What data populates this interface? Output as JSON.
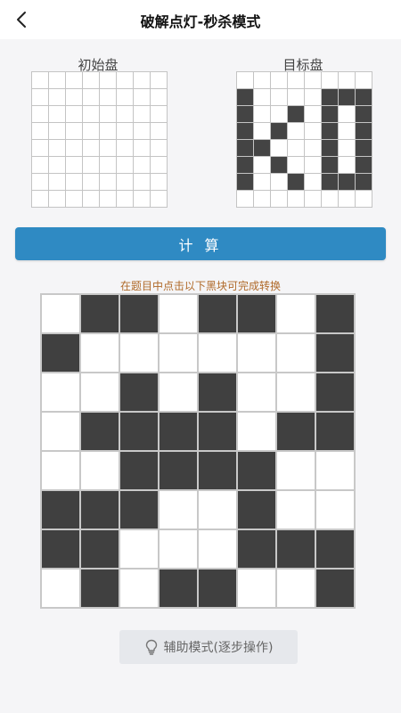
{
  "header": {
    "title": "破解点灯-秒杀模式",
    "back_icon": "chevron-left-icon"
  },
  "initial_board": {
    "label": "初始盘",
    "rows": [
      [
        0,
        0,
        0,
        0,
        0,
        0,
        0,
        0
      ],
      [
        0,
        0,
        0,
        0,
        0,
        0,
        0,
        0
      ],
      [
        0,
        0,
        0,
        0,
        0,
        0,
        0,
        0
      ],
      [
        0,
        0,
        0,
        0,
        0,
        0,
        0,
        0
      ],
      [
        0,
        0,
        0,
        0,
        0,
        0,
        0,
        0
      ],
      [
        0,
        0,
        0,
        0,
        0,
        0,
        0,
        0
      ],
      [
        0,
        0,
        0,
        0,
        0,
        0,
        0,
        0
      ],
      [
        0,
        0,
        0,
        0,
        0,
        0,
        0,
        0
      ]
    ]
  },
  "target_board": {
    "label": "目标盘",
    "rows": [
      [
        0,
        0,
        0,
        0,
        0,
        0,
        0,
        0
      ],
      [
        1,
        0,
        0,
        0,
        0,
        1,
        1,
        1
      ],
      [
        1,
        0,
        0,
        1,
        0,
        1,
        0,
        1
      ],
      [
        1,
        0,
        1,
        0,
        0,
        1,
        0,
        1
      ],
      [
        1,
        1,
        0,
        0,
        0,
        1,
        0,
        1
      ],
      [
        1,
        0,
        1,
        0,
        0,
        1,
        0,
        1
      ],
      [
        1,
        0,
        0,
        1,
        0,
        1,
        1,
        1
      ],
      [
        0,
        0,
        0,
        0,
        0,
        0,
        0,
        0
      ]
    ]
  },
  "calc_button": {
    "label": "计 算"
  },
  "hint": "在题目中点击以下黑块可完成转换",
  "solution_board": {
    "rows": [
      [
        0,
        1,
        1,
        0,
        1,
        1,
        0,
        1
      ],
      [
        1,
        0,
        0,
        0,
        0,
        0,
        0,
        1
      ],
      [
        0,
        0,
        1,
        0,
        1,
        0,
        0,
        1
      ],
      [
        0,
        1,
        1,
        1,
        1,
        0,
        1,
        1
      ],
      [
        0,
        0,
        1,
        1,
        1,
        1,
        0,
        0
      ],
      [
        1,
        1,
        1,
        0,
        0,
        1,
        0,
        0
      ],
      [
        1,
        1,
        0,
        0,
        0,
        1,
        1,
        1
      ],
      [
        0,
        1,
        0,
        1,
        1,
        0,
        0,
        1
      ]
    ]
  },
  "assist_button": {
    "label": "辅助模式(逐步操作)",
    "icon": "lightbulb-icon"
  },
  "colors": {
    "accent": "#2f8ac3",
    "cell_on": "#404040",
    "cell_off": "#ffffff",
    "hint_text": "#b06a2a"
  }
}
